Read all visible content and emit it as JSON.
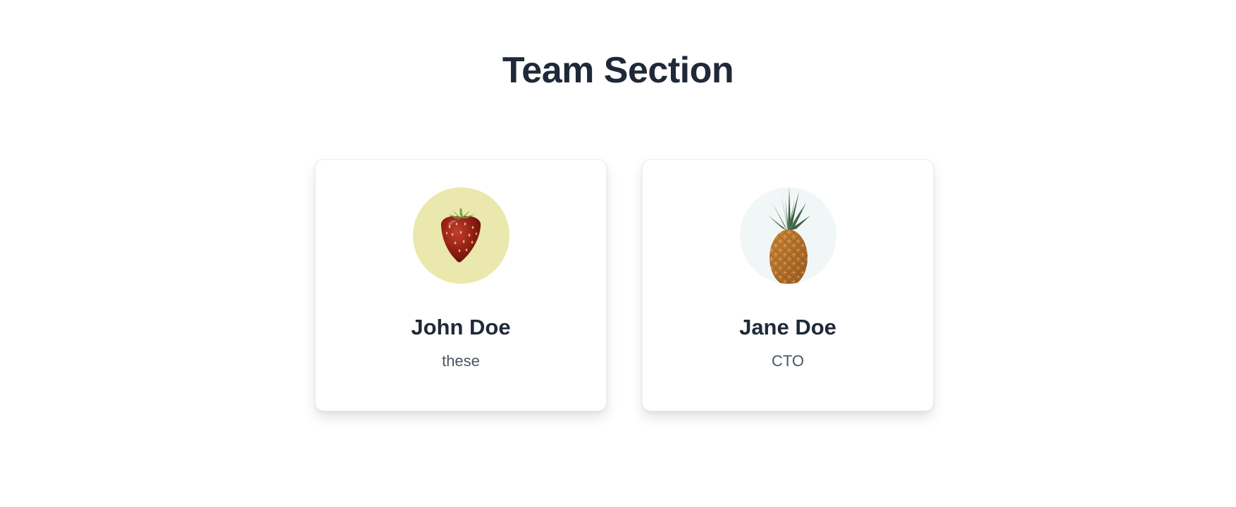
{
  "page": {
    "title": "Team Section"
  },
  "team": {
    "members": [
      {
        "name": "John Doe",
        "role": "these",
        "avatar_icon": "strawberry-icon",
        "avatar_bg": "#ebe8ad"
      },
      {
        "name": "Jane Doe",
        "role": "CTO",
        "avatar_icon": "pineapple-icon",
        "avatar_bg": "#f1f7f7"
      }
    ]
  },
  "colors": {
    "heading": "#1f2937",
    "subtext": "#4b5563",
    "card_bg": "#ffffff"
  }
}
